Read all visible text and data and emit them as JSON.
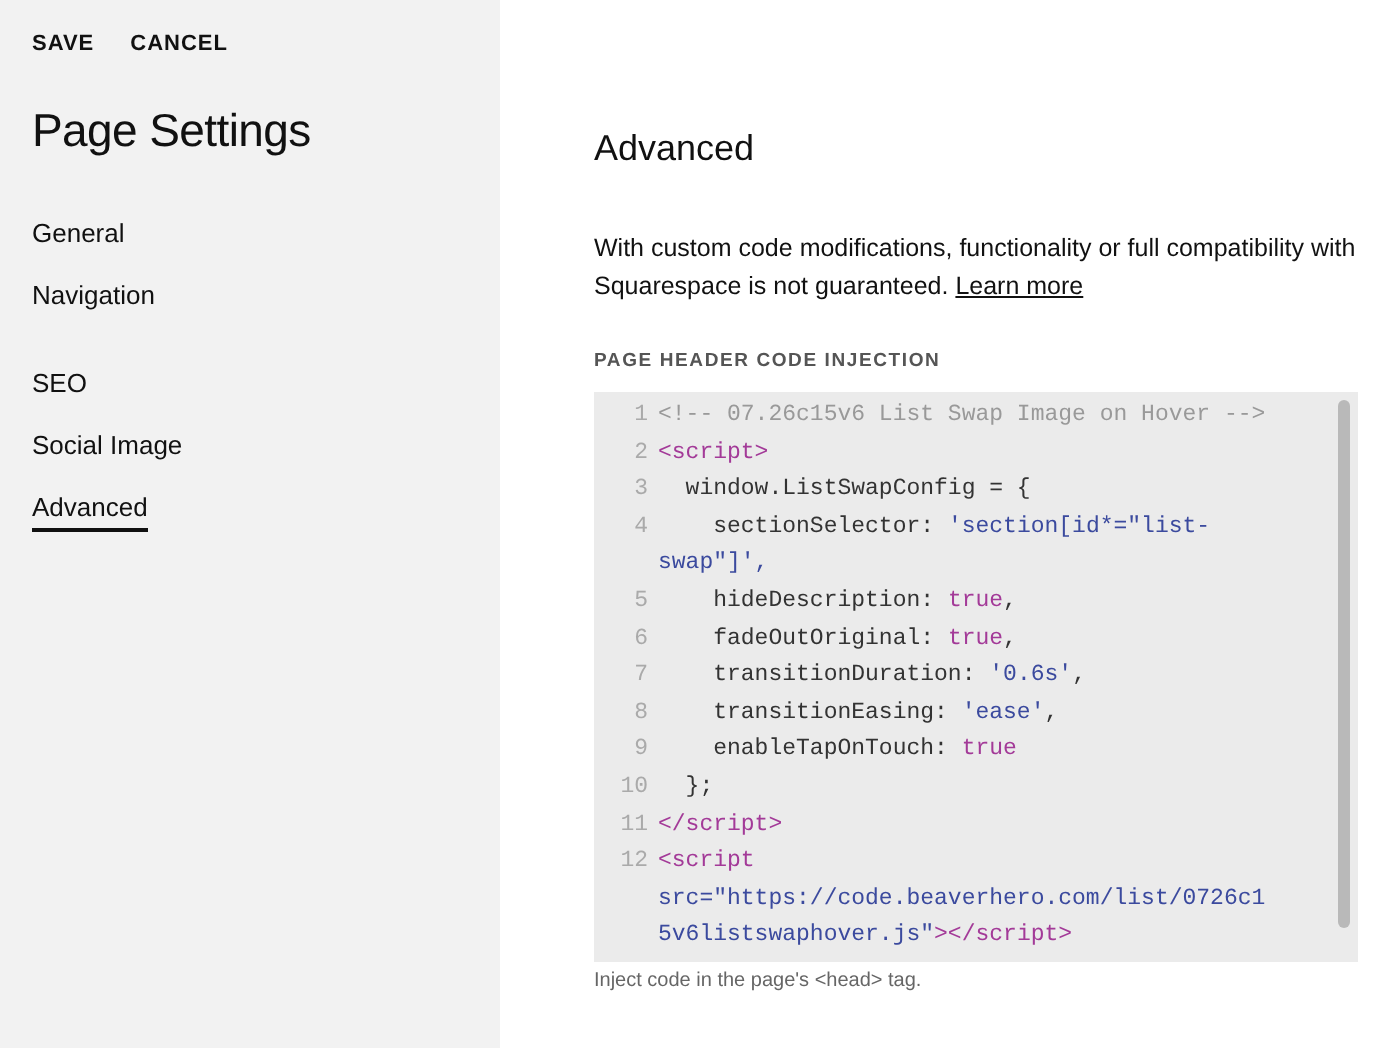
{
  "header_actions": [
    "SAVE",
    "CANCEL"
  ],
  "sidebar": {
    "title": "Page Settings",
    "groups": [
      [
        {
          "label": "General",
          "selected": false
        },
        {
          "label": "Navigation",
          "selected": false
        }
      ],
      [
        {
          "label": "SEO",
          "selected": false
        },
        {
          "label": "Social Image",
          "selected": false
        },
        {
          "label": "Advanced",
          "selected": true
        }
      ]
    ]
  },
  "main": {
    "title": "Advanced",
    "description": "With custom code modifications, functionality or full compatibility with Squarespace is not guaranteed.",
    "link": "Learn more",
    "section_label": "PAGE HEADER CODE INJECTION",
    "code_lines": [
      {
        "number": "1",
        "rows": [
          {
            "tokens": [
              {
                "kind": "comment",
                "text": "<!-- 07.26c15v6 List Swap Image on Hover -->"
              }
            ]
          }
        ]
      },
      {
        "number": "2",
        "rows": [
          {
            "tokens": [
              {
                "kind": "tag",
                "text": "<script>"
              }
            ]
          }
        ]
      },
      {
        "number": "3",
        "rows": [
          {
            "tokens": [
              {
                "kind": "plain",
                "text": "  window.ListSwapConfig = {"
              }
            ]
          }
        ]
      },
      {
        "number": "4",
        "rows": [
          {
            "tokens": [
              {
                "kind": "plain",
                "text": "    sectionSelector: "
              },
              {
                "kind": "string",
                "text": "'section[id*=\"list-"
              }
            ]
          },
          {
            "tokens": [
              {
                "kind": "string",
                "text": "swap\"]',"
              }
            ]
          }
        ]
      },
      {
        "number": "5",
        "rows": [
          {
            "tokens": [
              {
                "kind": "plain",
                "text": "    hideDescription: "
              },
              {
                "kind": "keyword",
                "text": "true"
              },
              {
                "kind": "plain",
                "text": ","
              }
            ]
          }
        ]
      },
      {
        "number": "6",
        "rows": [
          {
            "tokens": [
              {
                "kind": "plain",
                "text": "    fadeOutOriginal: "
              },
              {
                "kind": "keyword",
                "text": "true"
              },
              {
                "kind": "plain",
                "text": ","
              }
            ]
          }
        ]
      },
      {
        "number": "7",
        "rows": [
          {
            "tokens": [
              {
                "kind": "plain",
                "text": "    transitionDuration: "
              },
              {
                "kind": "string",
                "text": "'0.6s'"
              },
              {
                "kind": "plain",
                "text": ","
              }
            ]
          }
        ]
      },
      {
        "number": "8",
        "rows": [
          {
            "tokens": [
              {
                "kind": "plain",
                "text": "    transitionEasing: "
              },
              {
                "kind": "string",
                "text": "'ease'"
              },
              {
                "kind": "plain",
                "text": ","
              }
            ]
          }
        ]
      },
      {
        "number": "9",
        "rows": [
          {
            "tokens": [
              {
                "kind": "plain",
                "text": "    enableTapOnTouch: "
              },
              {
                "kind": "keyword",
                "text": "true"
              }
            ]
          }
        ]
      },
      {
        "number": "10",
        "rows": [
          {
            "tokens": [
              {
                "kind": "plain",
                "text": "  };"
              }
            ]
          }
        ]
      },
      {
        "number": "11",
        "rows": [
          {
            "tokens": [
              {
                "kind": "tag",
                "text": "</script>"
              }
            ]
          }
        ]
      },
      {
        "number": "12",
        "rows": [
          {
            "tokens": [
              {
                "kind": "tag",
                "text": "<script"
              }
            ]
          },
          {
            "tokens": [
              {
                "kind": "string",
                "text": "src=\"https://code.beaverhero.com/list/0726c1"
              }
            ]
          },
          {
            "tokens": [
              {
                "kind": "string",
                "text": "5v6listswaphover.js\""
              },
              {
                "kind": "tag",
                "text": "></script>"
              }
            ]
          }
        ]
      }
    ],
    "hint": "Inject code in the page's <head> tag."
  }
}
